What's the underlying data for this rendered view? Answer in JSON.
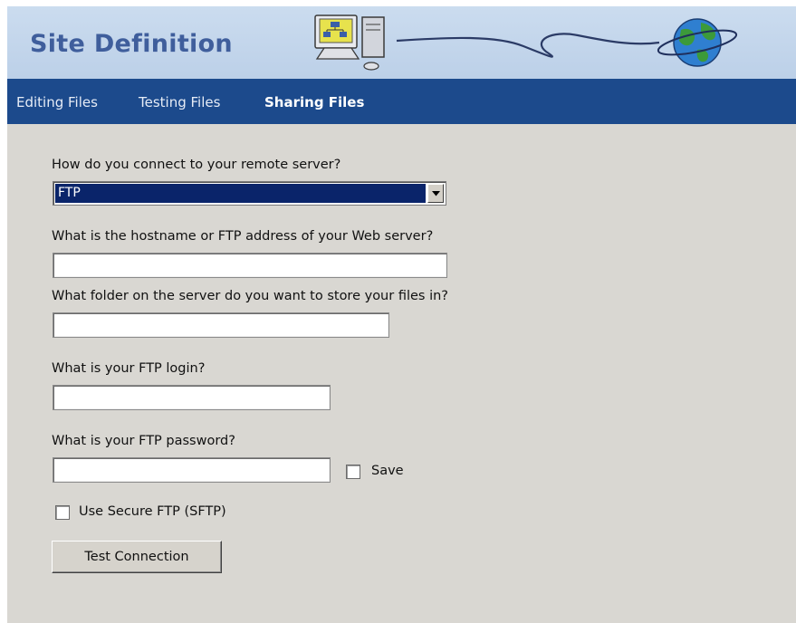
{
  "header": {
    "title": "Site Definition",
    "art_icons": [
      "computer-icon",
      "globe-icon"
    ]
  },
  "tabs": [
    {
      "label": "Editing Files",
      "active": false
    },
    {
      "label": "Testing Files",
      "active": false
    },
    {
      "label": "Sharing Files",
      "active": true
    }
  ],
  "form": {
    "connect_label": "How do you connect to your remote server?",
    "connect_value": "FTP",
    "hostname_label": "What is the hostname or FTP address of your Web server?",
    "hostname_value": "",
    "folder_label": "What folder on the server do you want to store your files in?",
    "folder_value": "",
    "login_label": "What is your FTP login?",
    "login_value": "",
    "password_label": "What is your FTP password?",
    "password_value": "",
    "save_label": "Save",
    "save_checked": false,
    "sftp_label": "Use Secure FTP (SFTP)",
    "sftp_checked": false,
    "test_button": "Test Connection"
  },
  "colors": {
    "banner": "#c4d7ee",
    "title_text": "#3f5e9c",
    "tabbar": "#1c4a8c",
    "panel": "#d9d7d2",
    "selection": "#0a246a"
  }
}
